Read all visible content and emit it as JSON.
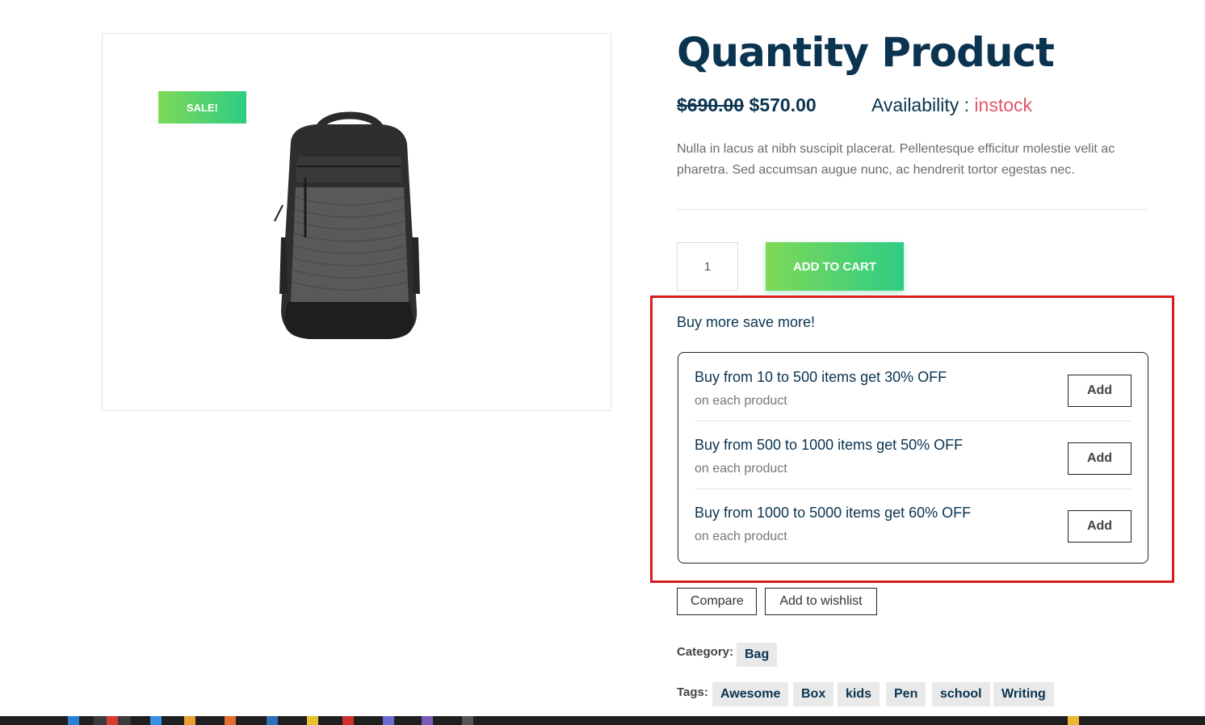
{
  "product": {
    "sale_badge": "SALE!",
    "title": "Quantity Product",
    "price_old": "$690.00",
    "price_new": "$570.00",
    "availability_label": "Availability : ",
    "availability_value": "instock",
    "description": "Nulla in lacus at nibh suscipit placerat. Pellentesque efficitur molestie velit ac pharetra. Sed accumsan augue nunc, ac hendrerit tortor egestas nec.",
    "quantity": "1",
    "add_to_cart_label": "ADD TO CART"
  },
  "offers": {
    "heading": "Buy more save more!",
    "items": [
      {
        "title": "Buy from 10 to 500 items get 30% OFF",
        "subtitle": "on each product",
        "button": "Add"
      },
      {
        "title": "Buy from 500 to 1000 items get 50% OFF",
        "subtitle": "on each product",
        "button": "Add"
      },
      {
        "title": "Buy from 1000 to 5000 items get 60% OFF",
        "subtitle": "on each product",
        "button": "Add"
      }
    ]
  },
  "actions": {
    "compare_label": "Compare",
    "wishlist_label": "Add to wishlist"
  },
  "meta": {
    "category_label": "Category:",
    "category": "Bag",
    "tags_label": "Tags:",
    "tags": [
      "Awesome",
      "Box",
      "kids",
      "Pen",
      "school",
      "Writing"
    ]
  },
  "colors": {
    "accent_gradient_start": "#7ed957",
    "accent_gradient_end": "#2ecc84",
    "title": "#0a3450",
    "instock": "#e0566c",
    "highlight_frame": "#d81f1f"
  }
}
